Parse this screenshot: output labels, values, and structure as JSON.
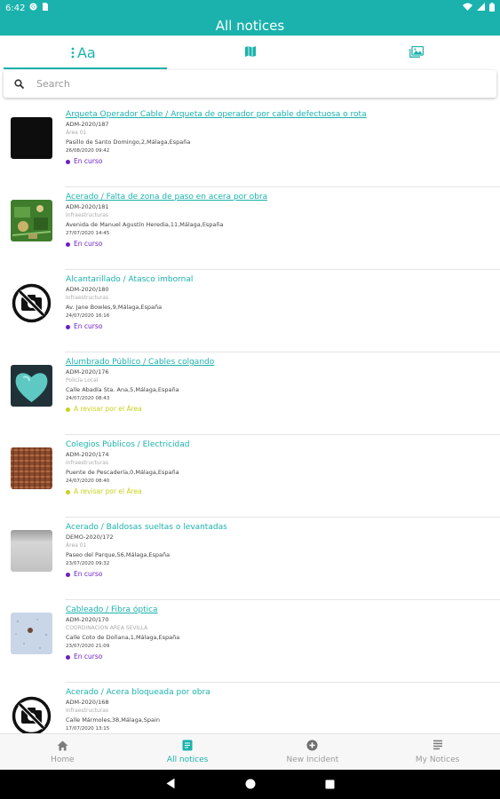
{
  "status_bar": {
    "time": "6:42"
  },
  "app_bar": {
    "title": "All notices"
  },
  "tabs": [
    {
      "label": "Aa",
      "icon": "list-text-icon"
    },
    {
      "label": "",
      "icon": "map-icon"
    },
    {
      "label": "",
      "icon": "gallery-icon"
    }
  ],
  "search": {
    "placeholder": "Search"
  },
  "notices": [
    {
      "title": "Arqueta Operador Cable / Arqueta de operador por cable defectuosa o rota",
      "code": "ADM-2020/187",
      "area": "Área 01",
      "address": "Pasillo de Santo Domingo,2,Málaga,España",
      "date": "26/08/2020 09:42",
      "status": "En curso",
      "status_color": "#6b1fc2",
      "thumb": "dark"
    },
    {
      "title": "Acerado / Falta de zona de paso en acera por obra",
      "code": "ADM-2020/181",
      "area": "Infraestructuras",
      "address": "Avenida de Manuel Agustín Heredia,11,Málaga,España",
      "date": "27/07/2020 14:45",
      "status": "En curso",
      "status_color": "#6b1fc2",
      "thumb": "circuit"
    },
    {
      "title": "Alcantarillado / Atasco imbornal",
      "code": "ADM-2020/180",
      "area": "Infraestructuras",
      "address": "Av. Jane Bowles,9,Málaga,España",
      "date": "24/07/2020 16:16",
      "status": "En curso",
      "status_color": "#6b1fc2",
      "thumb": "none"
    },
    {
      "title": "Alumbrado Público / Cables colgando",
      "code": "ADM-2020/176",
      "area": "Policía Local",
      "address": "Calle Abadía Sta. Ana,5,Málaga,España",
      "date": "24/07/2020 08:43",
      "status": "A revisar por el Área",
      "status_color": "#c9d21a",
      "thumb": "heart"
    },
    {
      "title": "Colegios Públicos / Electricidad",
      "code": "ADM-2020/174",
      "area": "Infraestructuras",
      "address": "Puente de Pescadería,0,Málaga,España",
      "date": "24/07/2020 08:40",
      "status": "A revisar por el Área",
      "status_color": "#c9d21a",
      "thumb": "fabric"
    },
    {
      "title": "Acerado / Baldosas sueltas o levantadas",
      "code": "DEMO-2020/172",
      "area": "Área 01",
      "address": "Paseo del Parque,56,Málaga,España",
      "date": "23/07/2020 09:32",
      "status": "En curso",
      "status_color": "#6b1fc2",
      "thumb": "grey"
    },
    {
      "title": "Cableado / Fibra óptica",
      "code": "ADM-2020/170",
      "area": "COORDINACION AREA SEVILLA",
      "address": "Calle Coto de Doñana,1,Málaga,España",
      "date": "23/07/2020 21:09",
      "status": "En curso",
      "status_color": "#6b1fc2",
      "thumb": "speckle"
    },
    {
      "title": "Acerado / Acera bloqueada por obra",
      "code": "ADM-2020/168",
      "area": "Infraestructuras",
      "address": "Calle Mármoles,38,Málaga,Spain",
      "date": "17/07/2020 13:15",
      "status": "",
      "status_color": "#6b1fc2",
      "thumb": "none"
    }
  ],
  "bottom_nav": [
    {
      "label": "Home",
      "icon": "home-icon"
    },
    {
      "label": "All notices",
      "icon": "notices-icon"
    },
    {
      "label": "New Incident",
      "icon": "add-circle-icon"
    },
    {
      "label": "My Notices",
      "icon": "my-notices-icon"
    }
  ],
  "colors": {
    "accent": "#1bb2ad",
    "status_in_progress": "#6b1fc2",
    "status_review": "#c9d21a"
  }
}
